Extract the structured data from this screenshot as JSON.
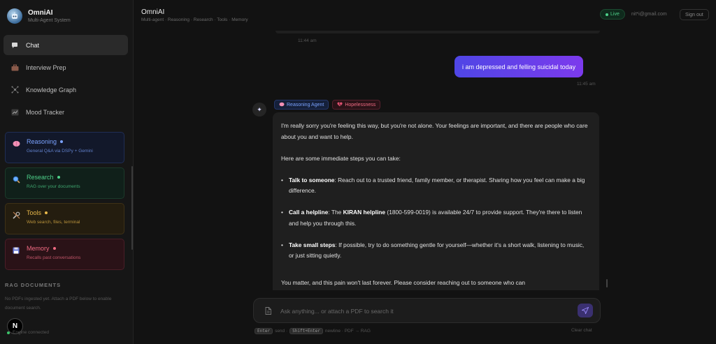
{
  "brand": {
    "title": "OmniAI",
    "subtitle": "Multi-Agent System"
  },
  "nav": [
    {
      "label": "Chat",
      "icon": "chat-bubble-icon",
      "active": true
    },
    {
      "label": "Interview Prep",
      "icon": "briefcase-icon",
      "active": false
    },
    {
      "label": "Knowledge Graph",
      "icon": "network-icon",
      "active": false
    },
    {
      "label": "Mood Tracker",
      "icon": "chart-icon",
      "active": false
    }
  ],
  "agents": [
    {
      "name": "Reasoning",
      "desc": "General Q&A via DSPy + Gemini",
      "color": "#7aa2ff",
      "icon": "brain-icon"
    },
    {
      "name": "Research",
      "desc": "RAG over your documents",
      "color": "#4ed18a",
      "icon": "magnifier-icon"
    },
    {
      "name": "Tools",
      "desc": "Web search, files, terminal",
      "color": "#e8b84a",
      "icon": "wrench-icon"
    },
    {
      "name": "Memory",
      "desc": "Recalls past conversations",
      "color": "#f06a82",
      "icon": "floppy-icon"
    }
  ],
  "rag": {
    "title": "RAG DOCUMENTS",
    "empty_text": "No PDFs ingested yet. Attach a PDF below to enable document search."
  },
  "engine_status": "Engine connected",
  "avatar_letter": "N",
  "header": {
    "title": "OmniAI",
    "subtitle": "Multi-agent · Reasoning · Research · Tools · Memory",
    "live": "Live",
    "email": "nit*i@gmail.com",
    "signout": "Sign out"
  },
  "chat": {
    "prev_time": "11:44 am",
    "user_message": "i am depressed and felling suicidal today",
    "user_time": "11:45 am",
    "agent_tag": "Reasoning Agent",
    "emotion_tag": "Hopelessness",
    "reply_intro": "I'm really sorry you're feeling this way, but you're not alone. Your feelings are important, and there are people who care about you and want to help.",
    "reply_steps_intro": "Here are some immediate steps you can take:",
    "steps": [
      {
        "title": "Talk to someone",
        "text": ": Reach out to a trusted friend, family member, or therapist. Sharing how you feel can make a big difference."
      },
      {
        "title": "Call a helpline",
        "text_pre": ": The ",
        "bold": "KIRAN helpline",
        "text": " (1800-599-0019) is available 24/7 to provide support. They're there to listen and help you through this."
      },
      {
        "title": "Take small steps",
        "text": ": If possible, try to do something gentle for yourself—whether it's a short walk, listening to music, or just sitting quietly."
      }
    ],
    "reply_closing": "You matter, and this pain won't last forever. Please consider reaching out to someone who can"
  },
  "composer": {
    "placeholder": "Ask anything... or attach a PDF to search it",
    "hint_enter_key": "Enter",
    "hint_enter_text": "send ·",
    "hint_shift_key": "Shift+Enter",
    "hint_shift_text": "newline · PDF → RAG",
    "clear": "Clear chat"
  }
}
